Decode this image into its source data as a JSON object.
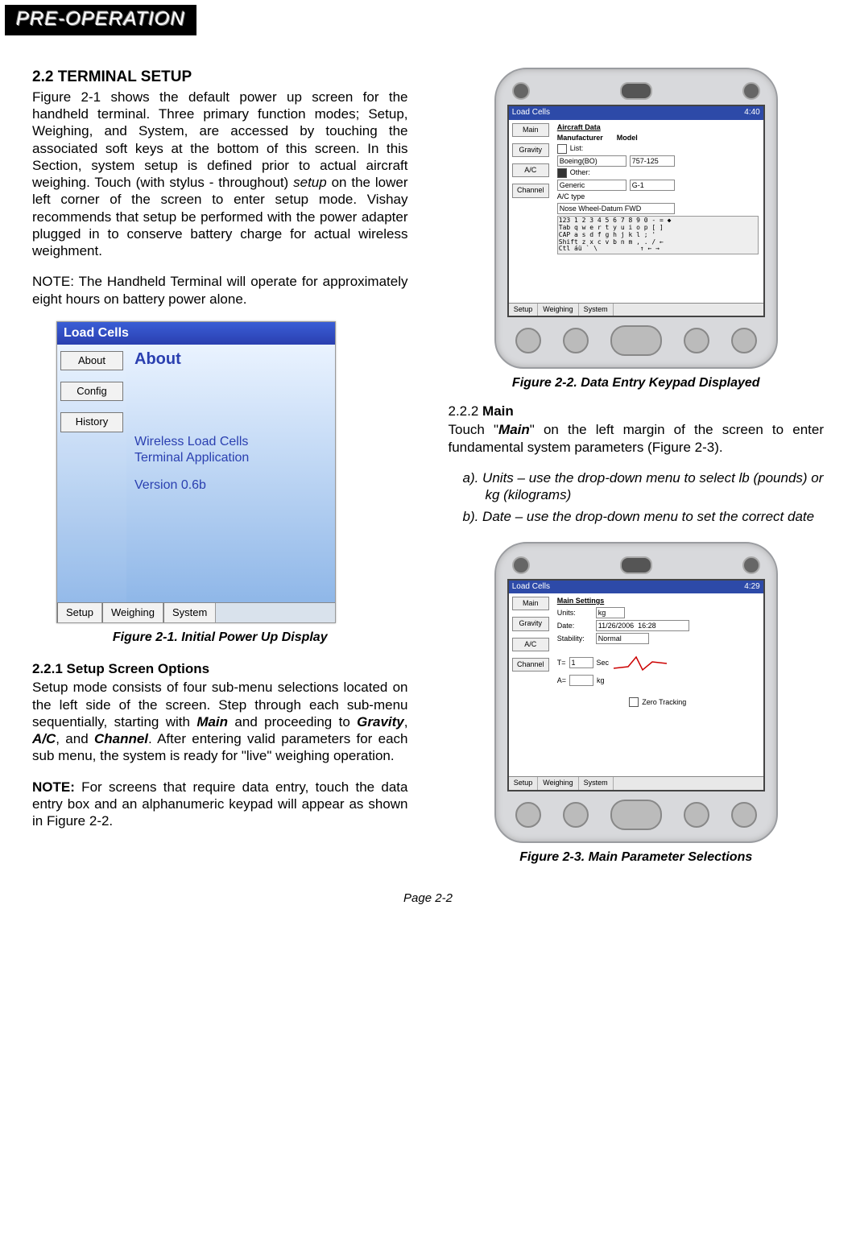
{
  "header_tab": "PRE-OPERATION",
  "left": {
    "h2": "2.2 TERMINAL SETUP",
    "p1a": "Figure 2-1 shows the default power up screen for the handheld terminal. Three primary function modes; Setup, Weighing, and System, are accessed by touching the associated soft keys at the bottom of this screen. In this Section, system setup is defined prior to actual aircraft weighing. Touch (with stylus - throughout) ",
    "p1_italic": "setup",
    "p1b": " on the lower left corner of the screen to enter setup mode. Vishay recommends that setup be performed with the power adapter plugged in to conserve battery charge for actual wireless weighment.",
    "note1": "NOTE: The Handheld Terminal will operate for approximately eight hours on battery power alone.",
    "fig21": {
      "titlebar": "Load Cells",
      "side": [
        "About",
        "Config",
        "History"
      ],
      "main_title": "About",
      "app_line1": "Wireless Load Cells",
      "app_line2": "Terminal Application",
      "version": "Version 0.6b",
      "bottom": [
        "Setup",
        "Weighing",
        "System"
      ]
    },
    "cap21": "Figure 2-1.  Initial Power Up Display",
    "sub221": "2.2.1 Setup Screen Options",
    "p221a": "Setup mode consists of four sub-menu selections located on the left side of the screen. Step through each sub-menu sequentially, starting with ",
    "p221_main": "Main",
    "p221b": " and proceeding to ",
    "p221_grav": "Gravity",
    "p221c": ", ",
    "p221_ac": "A/C",
    "p221d": ", and ",
    "p221_chan": "Channel",
    "p221e": ". After entering valid parameters for each sub menu, the system is ready for \"live\" weighing operation.",
    "note2_bold": "NOTE:",
    "note2_rest": " For screens that require data entry, touch the data entry box and an alphanumeric keypad will appear as shown in Figure 2-2."
  },
  "right": {
    "fig22": {
      "bar_title": "Load Cells",
      "bar_time": "4:40",
      "side": [
        "Main",
        "Gravity",
        "A/C",
        "Channel"
      ],
      "heading": "Aircraft Data",
      "col1": "Manufacturer",
      "col2": "Model",
      "list_label": "List:",
      "list_val": "Boeing(BO)",
      "model_val": "757-125",
      "other_label": "Other:",
      "generic": "Generic",
      "gval": "G-1",
      "actype": "A/C type",
      "actype_val": "Nose Wheel-Datum FWD",
      "kb_rows": "123 1 2 3 4 5 6 7 8 9 0 - = ◆\nTab q w e r t y u i o p [ ]\nCAP a s d f g h j k l ; '\nShift z x c v b n m , . / ←\nCtl áü ` \\           ↑ ← →",
      "bottom": [
        "Setup",
        "Weighing",
        "System"
      ]
    },
    "cap22": "Figure 2-2. Data Entry Keypad Displayed",
    "sub222_label": "2.2.2 ",
    "sub222_bold": "Main",
    "p222a": "Touch \"",
    "p222_main": "Main",
    "p222b": "\" on the left margin of the screen to enter fundamental system parameters (Figure 2-3).",
    "step_a": "a).  Units – use the drop-down menu to select lb (pounds) or kg (kilograms)",
    "step_b": "b).  Date – use the drop-down menu to set the correct date",
    "fig23": {
      "bar_title": "Load Cells",
      "bar_time": "4:29",
      "side": [
        "Main",
        "Gravity",
        "A/C",
        "Channel"
      ],
      "heading": "Main Settings",
      "units_label": "Units:",
      "units_val": "kg",
      "date_label": "Date:",
      "date_val": "11/26/2006  16:28",
      "stab_label": "Stability:",
      "stab_val": "Normal",
      "t_label": "T=",
      "t_val": "1",
      "t_unit": "Sec",
      "a_label": "A=",
      "a_unit": "kg",
      "zero": "Zero Tracking",
      "bottom": [
        "Setup",
        "Weighing",
        "System"
      ]
    },
    "cap23": "Figure 2-3. Main Parameter Selections"
  },
  "footer": "Page 2-2"
}
